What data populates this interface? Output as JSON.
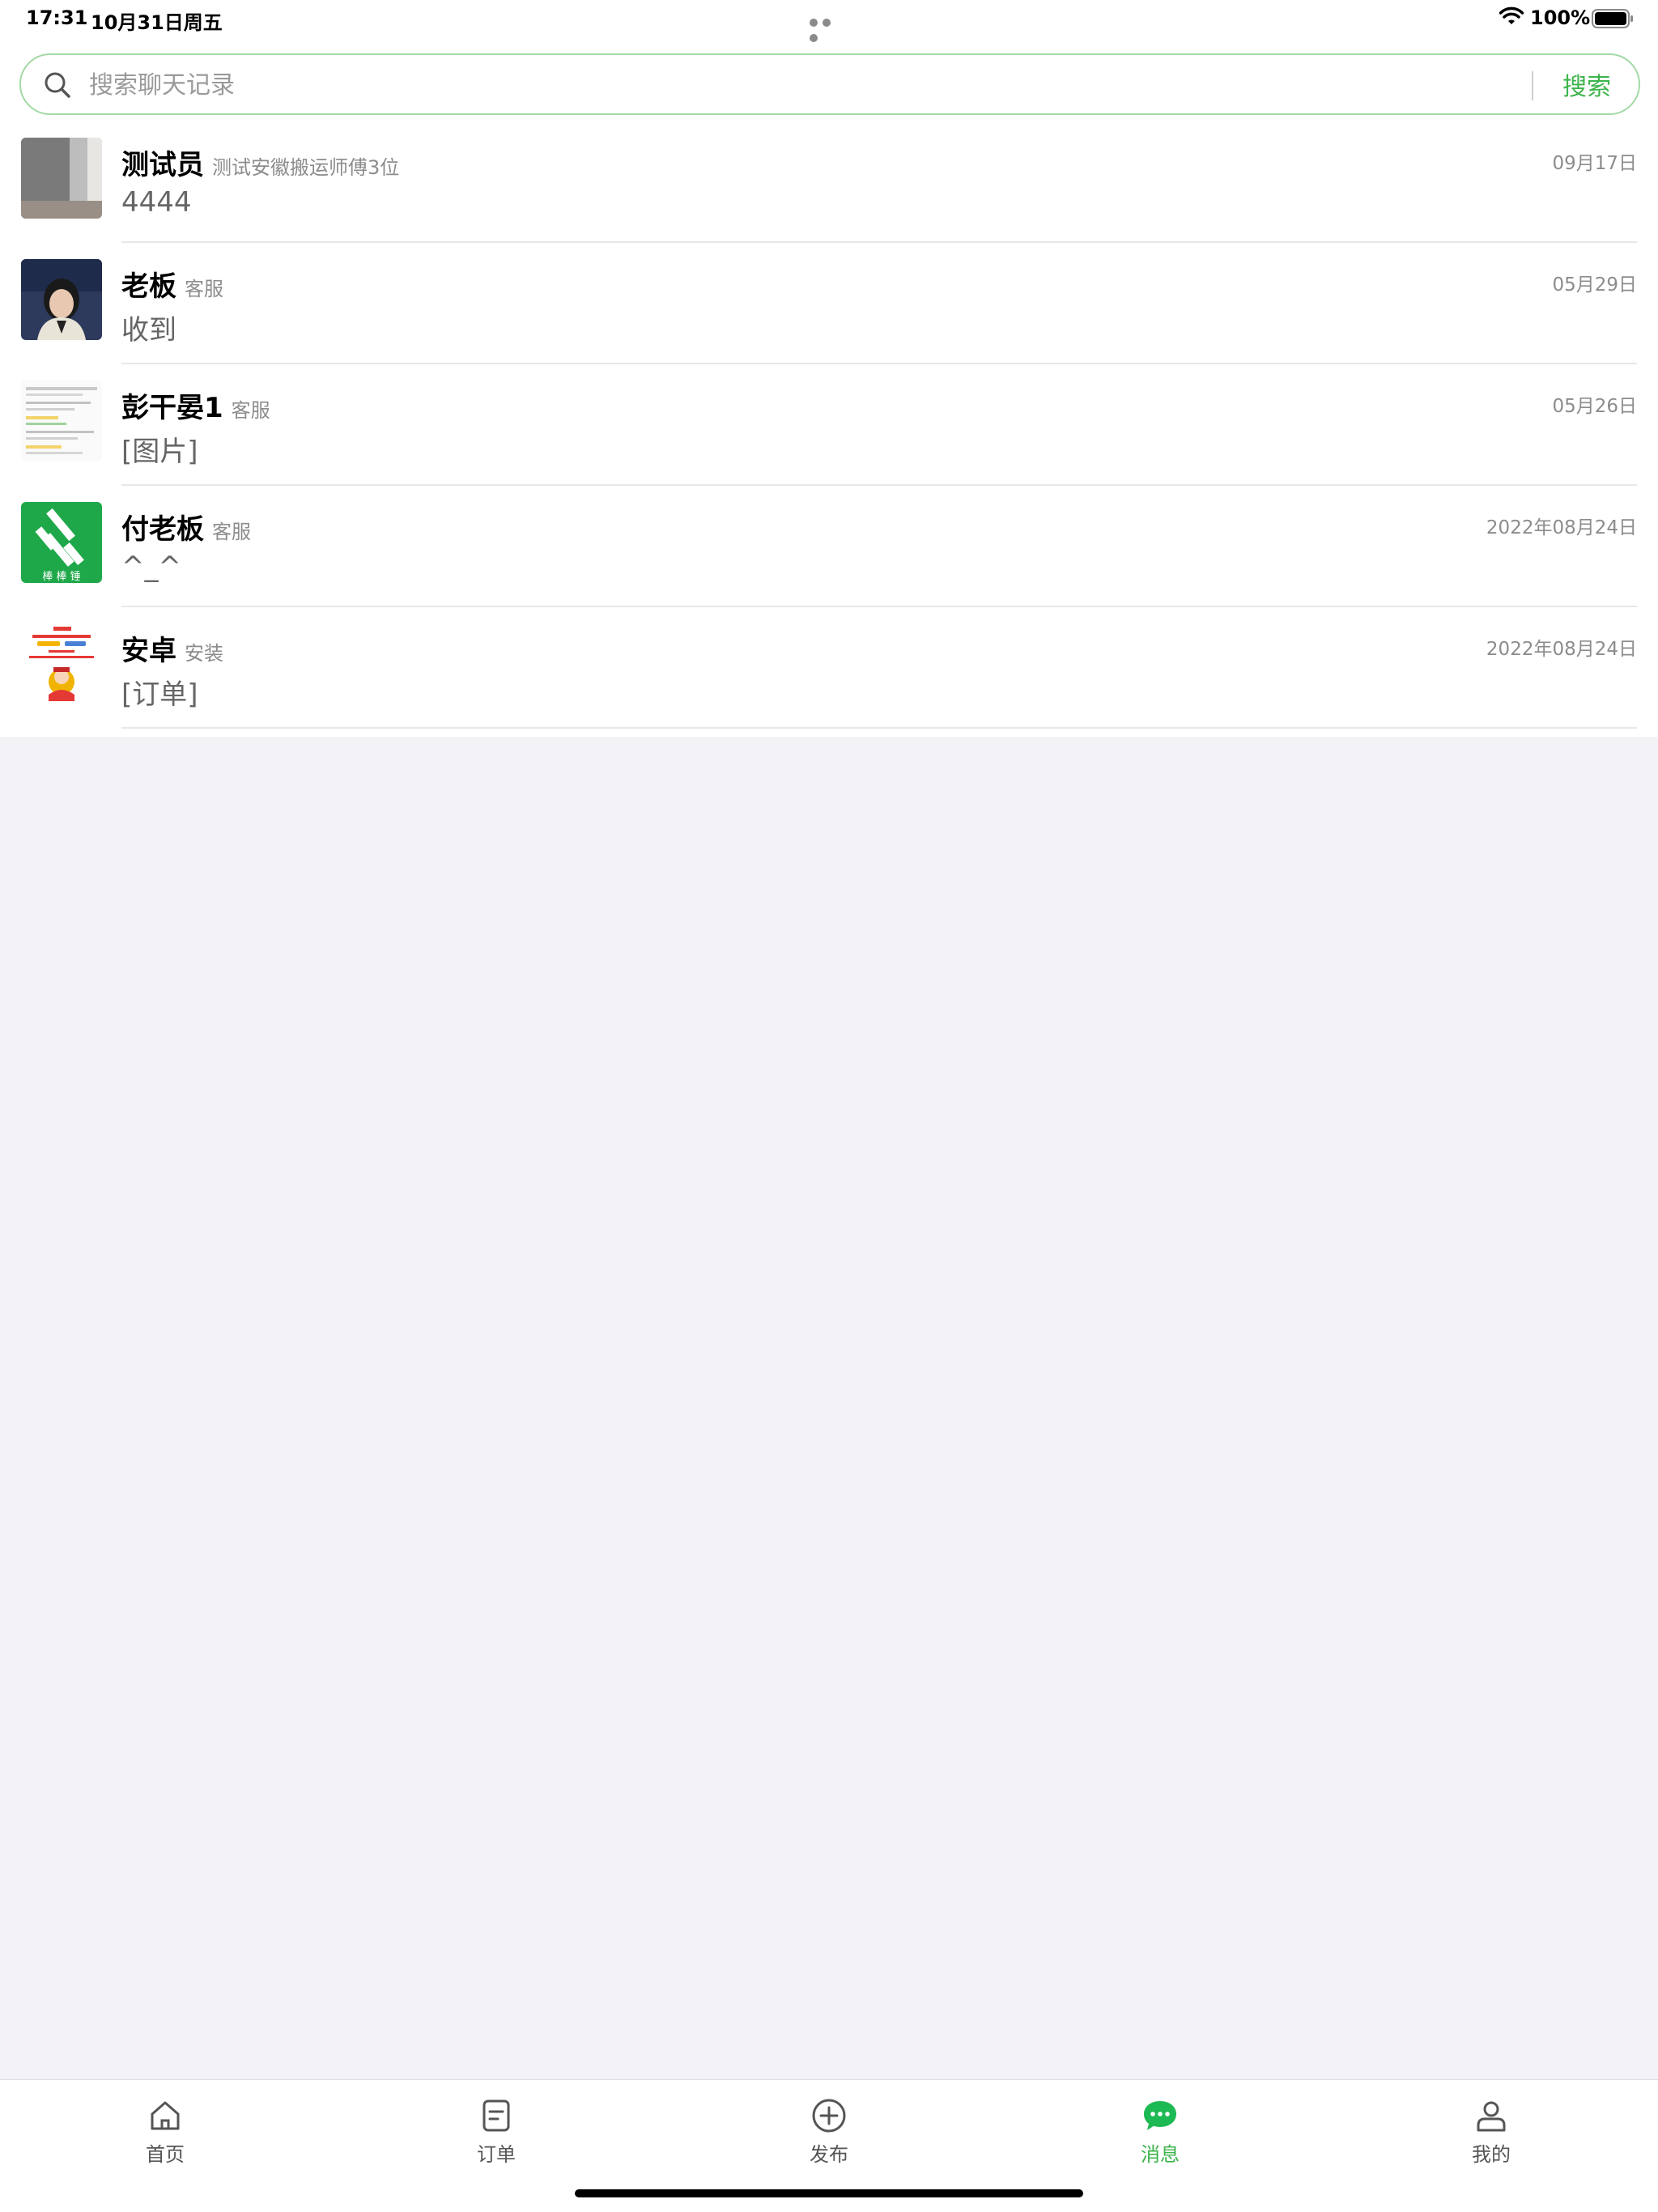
{
  "status_bar": {
    "time": "17:31",
    "date": "10月31日周五",
    "battery": "100%",
    "icons": [
      "wifi-icon",
      "battery-icon"
    ]
  },
  "search": {
    "placeholder": "搜索聊天记录",
    "button_label": "搜索",
    "accent": "#3cb44b",
    "border_color": "#a3d9a5"
  },
  "conversations": [
    {
      "name": "测试员",
      "role": "测试安徽搬运师傅3位",
      "time": "09月17日",
      "last_message": "4444",
      "avatar": "gray-wall-photo"
    },
    {
      "name": "老板",
      "role": "客服",
      "time": "05月29日",
      "last_message": "收到",
      "avatar": "person-photo"
    },
    {
      "name": "彭干晏1",
      "role": "客服",
      "time": "05月26日",
      "last_message": "[图片]",
      "avatar": "document-screenshot"
    },
    {
      "name": "付老板",
      "role": "客服",
      "time": "2022年08月24日",
      "last_message": "^_^",
      "avatar": "green-logo",
      "avatar_text": "棒 棒 锤"
    },
    {
      "name": "安卓",
      "role": "安装",
      "time": "2022年08月24日",
      "last_message": "[订单]",
      "avatar": "promo-poster"
    }
  ],
  "tab_bar": {
    "tabs": [
      {
        "label": "首页",
        "icon": "home-icon",
        "active": false
      },
      {
        "label": "订单",
        "icon": "order-icon",
        "active": false
      },
      {
        "label": "发布",
        "icon": "plus-circle-icon",
        "active": false
      },
      {
        "label": "消息",
        "icon": "message-icon",
        "active": true
      },
      {
        "label": "我的",
        "icon": "user-icon",
        "active": false
      }
    ],
    "active_color": "#3cb44b"
  }
}
